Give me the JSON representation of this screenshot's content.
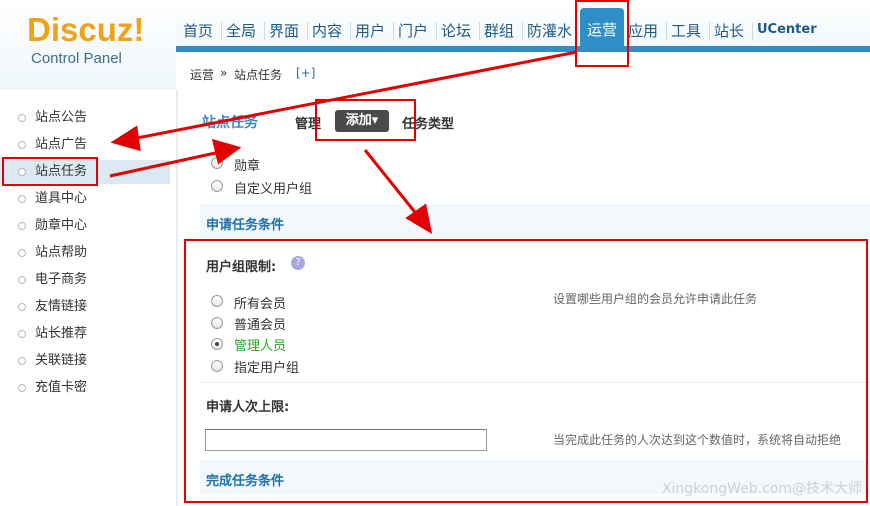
{
  "logo": {
    "brand": "Discuz",
    "bang": "!",
    "subtitle": "Control Panel"
  },
  "topnav": {
    "items": [
      "首页",
      "全局",
      "界面",
      "内容",
      "用户",
      "门户",
      "论坛",
      "群组",
      "防灌水",
      "运营",
      "应用",
      "工具",
      "站长",
      "UCenter"
    ],
    "active": "运营"
  },
  "breadcrumb": {
    "section": "运营",
    "sep": "»",
    "page": "站点任务",
    "add": "[+]"
  },
  "sidebar": {
    "items": [
      "站点公告",
      "站点广告",
      "站点任务",
      "道具中心",
      "勋章中心",
      "站点帮助",
      "电子商务",
      "友情链接",
      "站长推荐",
      "关联链接",
      "充值卡密"
    ],
    "active": "站点任务"
  },
  "main": {
    "title": "站点任务",
    "tabs": {
      "manage": "管理",
      "add": "添加",
      "add_arrow": "▾",
      "type": "任务类型"
    },
    "task_types": [
      "勋章",
      "自定义用户组"
    ],
    "apply_section": "申请任务条件",
    "usergroup_label": "用户组限制:",
    "help_glyph": "?",
    "usergroup_options": [
      "所有会员",
      "普通会员",
      "管理人员",
      "指定用户组"
    ],
    "usergroup_selected": "管理人员",
    "usergroup_hint": "设置哪些用户组的会员允许申请此任务",
    "limit_label": "申请人次上限:",
    "limit_value": "",
    "limit_hint": "当完成此任务的人次达到这个数值时，系统将自动拒绝",
    "complete_section": "完成任务条件"
  },
  "watermark": "XingkongWeb.com@技术大师",
  "colors": {
    "accent": "#2e8fc7",
    "annotation": "#e30000",
    "selected_text": "#22aa22"
  }
}
